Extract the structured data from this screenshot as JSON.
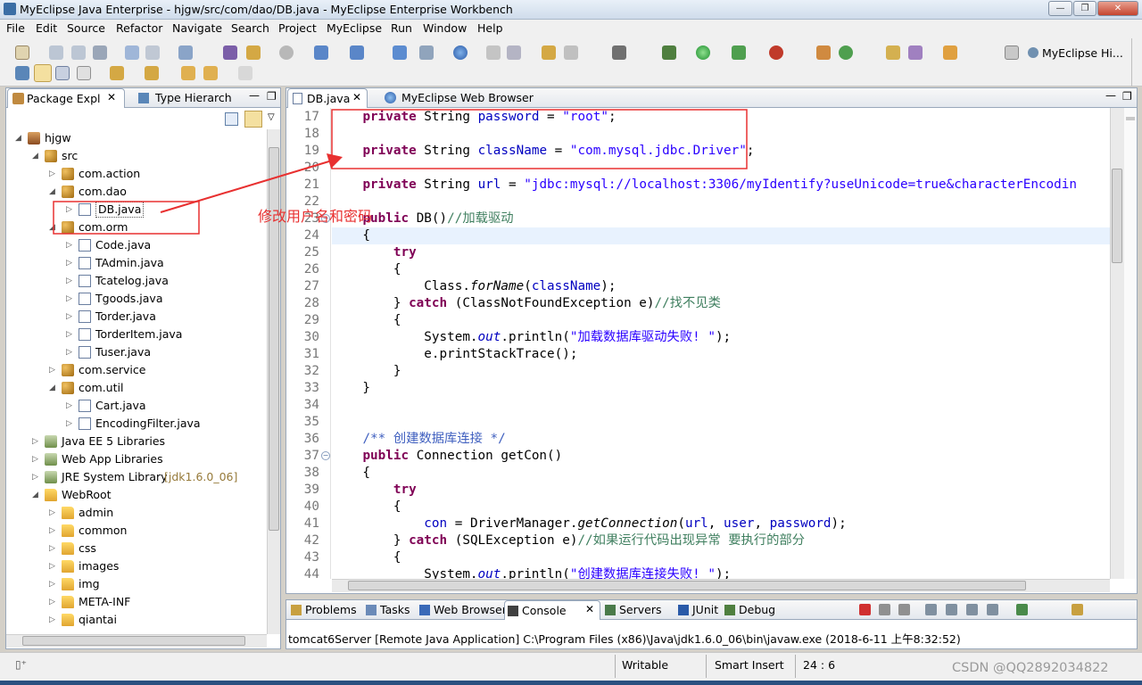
{
  "window": {
    "title": "MyEclipse Java Enterprise - hjgw/src/com/dao/DB.java - MyEclipse Enterprise Workbench"
  },
  "menu": [
    "File",
    "Edit",
    "Source",
    "Refactor",
    "Navigate",
    "Search",
    "Project",
    "MyEclipse",
    "Run",
    "Window",
    "Help"
  ],
  "perspective": {
    "label": "MyEclipse Hi..."
  },
  "left_panel": {
    "tabs": [
      "Package Expl",
      "Type Hierarch"
    ],
    "tree": [
      {
        "label": "hjgw",
        "depth": 0,
        "icon": "project-icon",
        "expanded": true
      },
      {
        "label": "src",
        "depth": 1,
        "icon": "source-folder-icon",
        "expanded": true
      },
      {
        "label": "com.action",
        "depth": 2,
        "icon": "package-icon",
        "expanded": false
      },
      {
        "label": "com.dao",
        "depth": 2,
        "icon": "package-icon",
        "expanded": true
      },
      {
        "label": "DB.java",
        "depth": 3,
        "icon": "java-file-icon",
        "expanded": false,
        "selected": true
      },
      {
        "label": "com.orm",
        "depth": 2,
        "icon": "package-icon",
        "expanded": true
      },
      {
        "label": "Code.java",
        "depth": 3,
        "icon": "java-file-icon",
        "expanded": false
      },
      {
        "label": "TAdmin.java",
        "depth": 3,
        "icon": "java-file-icon",
        "expanded": false
      },
      {
        "label": "Tcatelog.java",
        "depth": 3,
        "icon": "java-file-icon",
        "expanded": false
      },
      {
        "label": "Tgoods.java",
        "depth": 3,
        "icon": "java-file-icon",
        "expanded": false
      },
      {
        "label": "Torder.java",
        "depth": 3,
        "icon": "java-file-icon",
        "expanded": false
      },
      {
        "label": "TorderItem.java",
        "depth": 3,
        "icon": "java-file-icon",
        "expanded": false
      },
      {
        "label": "Tuser.java",
        "depth": 3,
        "icon": "java-file-icon",
        "expanded": false
      },
      {
        "label": "com.service",
        "depth": 2,
        "icon": "package-icon",
        "expanded": false
      },
      {
        "label": "com.util",
        "depth": 2,
        "icon": "package-icon",
        "expanded": true
      },
      {
        "label": "Cart.java",
        "depth": 3,
        "icon": "java-file-icon",
        "expanded": false
      },
      {
        "label": "EncodingFilter.java",
        "depth": 3,
        "icon": "java-file-icon",
        "expanded": false
      },
      {
        "label": "Java EE 5 Libraries",
        "depth": 1,
        "icon": "library-icon",
        "expanded": false
      },
      {
        "label": "Web App Libraries",
        "depth": 1,
        "icon": "library-icon",
        "expanded": false
      },
      {
        "label": "JRE System Library",
        "suffix": "[jdk1.6.0_06]",
        "depth": 1,
        "icon": "library-icon",
        "expanded": false
      },
      {
        "label": "WebRoot",
        "depth": 1,
        "icon": "folder-icon",
        "expanded": true
      },
      {
        "label": "admin",
        "depth": 2,
        "icon": "folder-icon",
        "expanded": false
      },
      {
        "label": "common",
        "depth": 2,
        "icon": "folder-icon",
        "expanded": false
      },
      {
        "label": "css",
        "depth": 2,
        "icon": "folder-icon",
        "expanded": false
      },
      {
        "label": "images",
        "depth": 2,
        "icon": "folder-icon",
        "expanded": false
      },
      {
        "label": "img",
        "depth": 2,
        "icon": "folder-icon",
        "expanded": false
      },
      {
        "label": "META-INF",
        "depth": 2,
        "icon": "folder-icon",
        "expanded": false
      },
      {
        "label": "qiantai",
        "depth": 2,
        "icon": "folder-icon",
        "expanded": false
      }
    ]
  },
  "editor": {
    "tabs": [
      "DB.java",
      "MyEclipse Web Browser"
    ],
    "lines": [
      {
        "n": "17",
        "tokens": [
          [
            "    ",
            ""
          ],
          [
            "private",
            "kw"
          ],
          [
            " String ",
            ""
          ],
          [
            "password",
            "fld"
          ],
          [
            " = ",
            ""
          ],
          [
            "\"root\"",
            "str"
          ],
          [
            ";",
            ""
          ]
        ]
      },
      {
        "n": "18",
        "tokens": []
      },
      {
        "n": "19",
        "tokens": [
          [
            "    ",
            ""
          ],
          [
            "private",
            "kw"
          ],
          [
            " String ",
            ""
          ],
          [
            "className",
            "fld"
          ],
          [
            " = ",
            ""
          ],
          [
            "\"com.mysql.jdbc.Driver\"",
            "str"
          ],
          [
            ";",
            ""
          ]
        ]
      },
      {
        "n": "20",
        "tokens": []
      },
      {
        "n": "21",
        "tokens": [
          [
            "    ",
            ""
          ],
          [
            "private",
            "kw"
          ],
          [
            " String ",
            ""
          ],
          [
            "url",
            "fld"
          ],
          [
            " = ",
            ""
          ],
          [
            "\"jdbc:mysql://localhost:3306/myIdentify?useUnicode=true&characterEncodin",
            "str"
          ]
        ]
      },
      {
        "n": "22",
        "tokens": []
      },
      {
        "n": "23",
        "tokens": [
          [
            "    ",
            ""
          ],
          [
            "public",
            "kw"
          ],
          [
            " DB()",
            ""
          ],
          [
            "//加载驱动",
            "cmt"
          ]
        ]
      },
      {
        "n": "24",
        "tokens": [
          [
            "    {",
            ""
          ]
        ],
        "current": true
      },
      {
        "n": "25",
        "tokens": [
          [
            "        ",
            ""
          ],
          [
            "try",
            "kw"
          ]
        ]
      },
      {
        "n": "26",
        "tokens": [
          [
            "        {",
            ""
          ]
        ]
      },
      {
        "n": "27",
        "tokens": [
          [
            "            Class.",
            ""
          ],
          [
            "forName",
            "itl"
          ],
          [
            "(",
            ""
          ],
          [
            "className",
            "fld"
          ],
          [
            ");",
            ""
          ]
        ]
      },
      {
        "n": "28",
        "tokens": [
          [
            "        } ",
            ""
          ],
          [
            "catch",
            "kw"
          ],
          [
            " (ClassNotFoundException e)",
            ""
          ],
          [
            "//找不见类",
            "cmt"
          ]
        ]
      },
      {
        "n": "29",
        "tokens": [
          [
            "        {",
            ""
          ]
        ]
      },
      {
        "n": "30",
        "tokens": [
          [
            "            System.",
            ""
          ],
          [
            "out",
            "fld itl"
          ],
          [
            ".println(",
            ""
          ],
          [
            "\"加载数据库驱动失败! \"",
            "str"
          ],
          [
            ");",
            ""
          ]
        ]
      },
      {
        "n": "31",
        "tokens": [
          [
            "            e.printStackTrace();",
            ""
          ]
        ]
      },
      {
        "n": "32",
        "tokens": [
          [
            "        }",
            ""
          ]
        ]
      },
      {
        "n": "33",
        "tokens": [
          [
            "    }",
            ""
          ]
        ]
      },
      {
        "n": "34",
        "tokens": []
      },
      {
        "n": "35",
        "tokens": []
      },
      {
        "n": "36",
        "tokens": [
          [
            "    ",
            ""
          ],
          [
            "/** 创建数据库连接 */",
            "doc"
          ]
        ]
      },
      {
        "n": "37",
        "tokens": [
          [
            "    ",
            ""
          ],
          [
            "public",
            "kw"
          ],
          [
            " Connection getCon()",
            ""
          ]
        ]
      },
      {
        "n": "38",
        "tokens": [
          [
            "    {",
            ""
          ]
        ]
      },
      {
        "n": "39",
        "tokens": [
          [
            "        ",
            ""
          ],
          [
            "try",
            "kw"
          ]
        ]
      },
      {
        "n": "40",
        "tokens": [
          [
            "        {",
            ""
          ]
        ]
      },
      {
        "n": "41",
        "tokens": [
          [
            "            ",
            ""
          ],
          [
            "con",
            "fld"
          ],
          [
            " = DriverManager.",
            ""
          ],
          [
            "getConnection",
            "itl"
          ],
          [
            "(",
            ""
          ],
          [
            "url",
            "fld"
          ],
          [
            ", ",
            ""
          ],
          [
            "user",
            "fld"
          ],
          [
            ", ",
            ""
          ],
          [
            "password",
            "fld"
          ],
          [
            ");",
            ""
          ]
        ]
      },
      {
        "n": "42",
        "tokens": [
          [
            "        } ",
            ""
          ],
          [
            "catch",
            "kw"
          ],
          [
            " (SQLException e)",
            ""
          ],
          [
            "//如果运行代码出现异常 要执行的部分",
            "cmt"
          ]
        ]
      },
      {
        "n": "43",
        "tokens": [
          [
            "        {",
            ""
          ]
        ]
      },
      {
        "n": "44",
        "tokens": [
          [
            "            System.",
            ""
          ],
          [
            "out",
            "fld itl"
          ],
          [
            ".println(",
            ""
          ],
          [
            "\"创建数据库连接失败! \"",
            "str"
          ],
          [
            ");",
            ""
          ]
        ]
      }
    ]
  },
  "annotation": {
    "text": "修改用户名和密码",
    "color": "#e83030"
  },
  "console": {
    "tabs": [
      "Problems",
      "Tasks",
      "Web Browser",
      "Console",
      "Servers",
      "JUnit",
      "Debug"
    ],
    "output": "tomcat6Server [Remote Java Application] C:\\Program Files (x86)\\Java\\jdk1.6.0_06\\bin\\javaw.exe (2018-6-11 上午8:32:52)"
  },
  "status": {
    "mode": "Writable",
    "insert": "Smart Insert",
    "position": "24 : 6",
    "watermark": "CSDN @QQ2892034822"
  }
}
